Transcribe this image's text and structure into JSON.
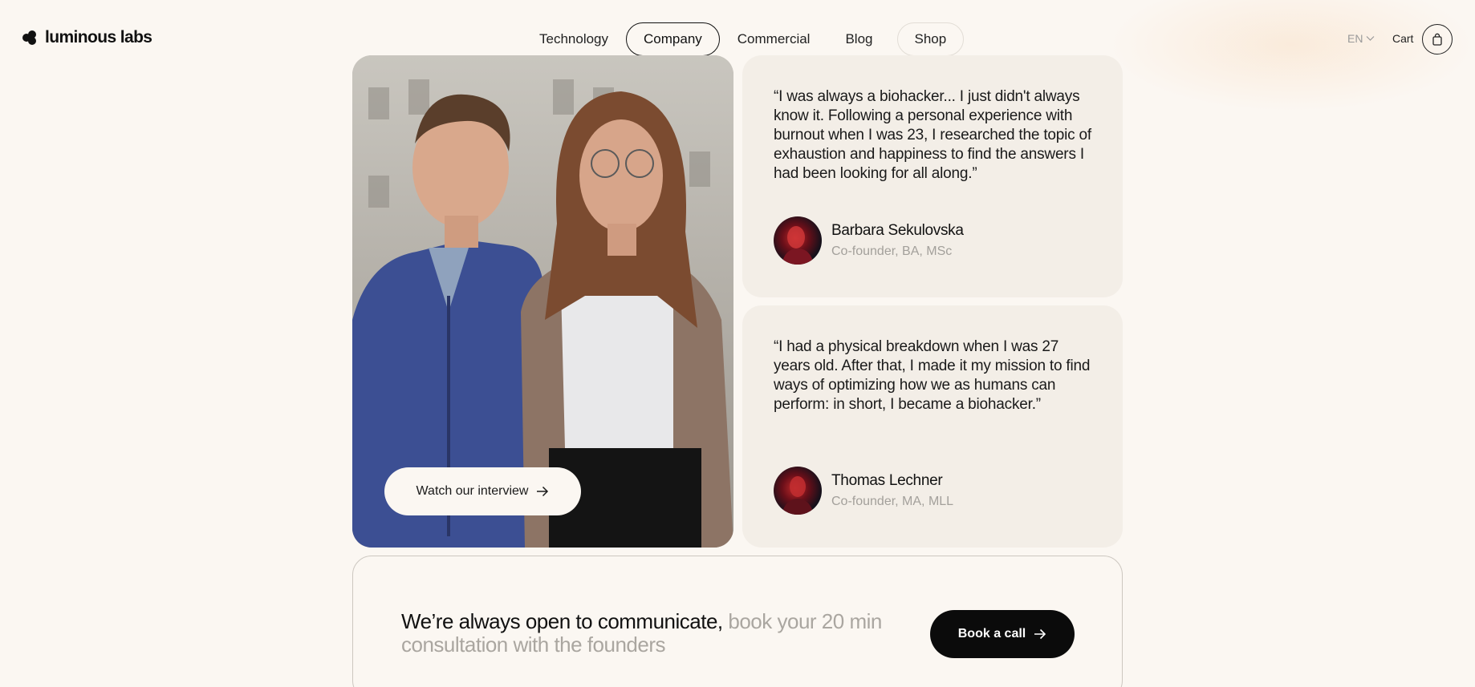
{
  "header": {
    "logo_text": "luminous labs",
    "nav": [
      {
        "label": "Technology"
      },
      {
        "label": "Company"
      },
      {
        "label": "Commercial"
      },
      {
        "label": "Blog"
      },
      {
        "label": "Shop"
      }
    ],
    "language": "EN",
    "cart_label": "Cart"
  },
  "hero": {
    "watch_label": "Watch our interview"
  },
  "quotes": [
    {
      "text": "“I was always a biohacker... I just didn't always know it. Following a personal experience with burnout when I was 23, I researched the topic of exhaustion and happiness to find the answers I had been looking for all along.”",
      "name": "Barbara Sekulovska",
      "role": "Co-founder, BA, MSc"
    },
    {
      "text": "“I had a physical breakdown when I was 27 years old. After that, I made it my mission to find ways of optimizing how we as humans can perform: in short, I became a biohacker.”",
      "name": "Thomas Lechner",
      "role": "Co-founder, MA, MLL"
    }
  ],
  "cta": {
    "lead": "We’re always open to communicate,",
    "muted": "book your 20 min consultation with the founders",
    "button": "Book a call"
  },
  "colors": {
    "background": "#fbf7f2",
    "card": "#f3eee7",
    "button_dark": "#0b0b0b",
    "muted_text": "#a3a09b"
  }
}
